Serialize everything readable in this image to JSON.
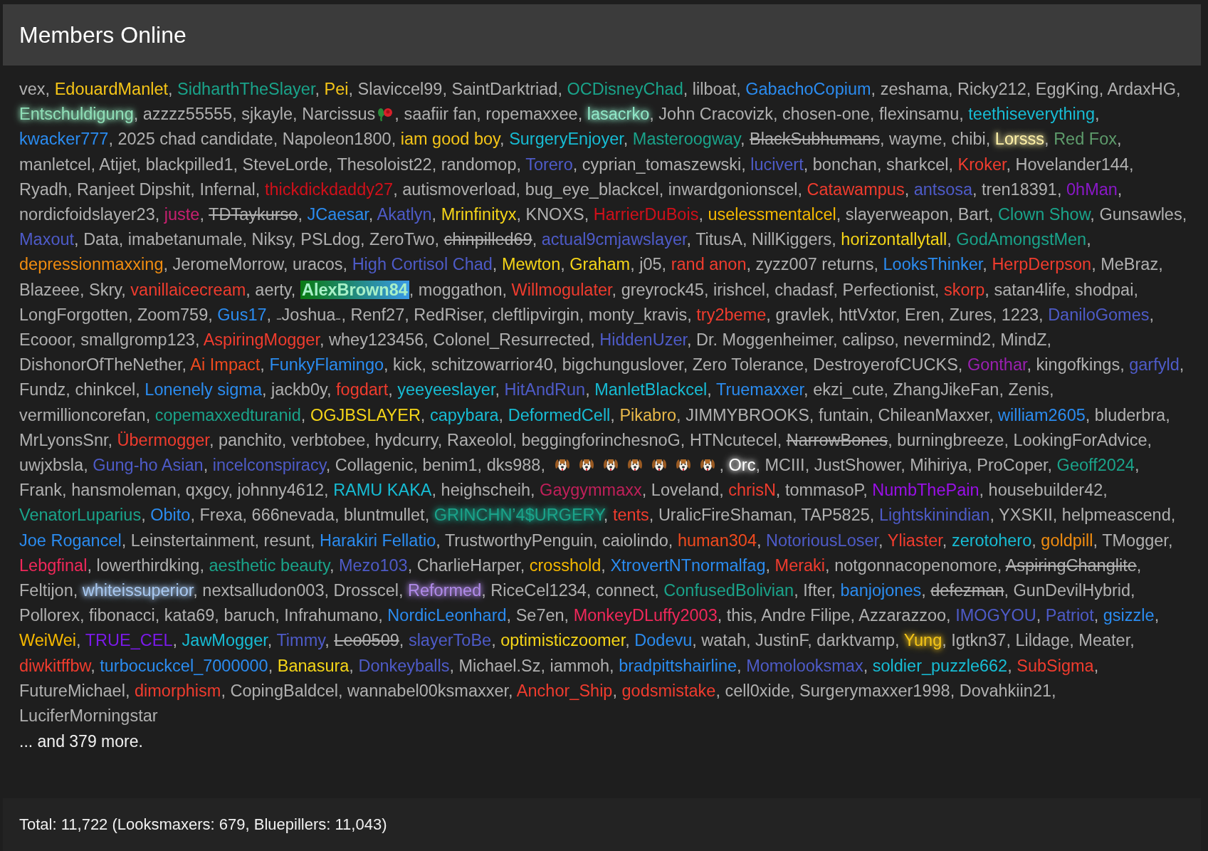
{
  "panel": {
    "title": "Members Online"
  },
  "members": {
    "separator": ", ",
    "items": [
      {
        "name": "vex"
      },
      {
        "name": "EdouardManlet",
        "color": "#f5c518"
      },
      {
        "name": "SidharthTheSlayer",
        "color": "#1aa38a"
      },
      {
        "name": "Pei",
        "color": "#f5c518"
      },
      {
        "name": "Slaviccel99"
      },
      {
        "name": "SaintDarktriad"
      },
      {
        "name": "OCDisneyChad",
        "color": "#1aa38a"
      },
      {
        "name": "lilboat"
      },
      {
        "name": "GabachoCopium",
        "color": "#2b8cf0"
      },
      {
        "name": "zeshama"
      },
      {
        "name": "Ricky212"
      },
      {
        "name": "EggKing"
      },
      {
        "name": "ArdaxHG"
      },
      {
        "name": "Entschuldigung",
        "color": "#90e0b8",
        "glow": true
      },
      {
        "name": "azzzz55555"
      },
      {
        "name": "sjkayle"
      },
      {
        "name": "Narcissus",
        "icons": [
          {
            "kind": "flower"
          }
        ]
      },
      {
        "name": "saafiir fan"
      },
      {
        "name": "ropemaxxee"
      },
      {
        "name": "lasacrko",
        "color": "#90e8c8",
        "glow": true
      },
      {
        "name": "John Cracovizk"
      },
      {
        "name": "chosen-one"
      },
      {
        "name": "flexinsamu"
      },
      {
        "name": "teethiseverything",
        "color": "#17bcd4"
      },
      {
        "name": "kwacker777",
        "color": "#2b8cf0"
      },
      {
        "name": "2025 chad candidate"
      },
      {
        "name": "Napoleon1800"
      },
      {
        "name": "iam good boy",
        "color": "#f5c518"
      },
      {
        "name": "SurgeryEnjoyer",
        "color": "#17bcd4"
      },
      {
        "name": "Masteroogway",
        "color": "#1aa38a"
      },
      {
        "name": "BlackSubhumans",
        "struck": true
      },
      {
        "name": "wayme"
      },
      {
        "name": "chibi"
      },
      {
        "name": "Lorsss",
        "color": "#fff2a8",
        "glow": true
      },
      {
        "name": "Red Fox",
        "color": "#5e9c6c"
      },
      {
        "name": "manletcel"
      },
      {
        "name": "Atijet"
      },
      {
        "name": "blackpilled1"
      },
      {
        "name": "SteveLorde"
      },
      {
        "name": "Thesoloist22"
      },
      {
        "name": "randomop"
      },
      {
        "name": "Torero",
        "color": "#4e5bc8"
      },
      {
        "name": "cyprian_tomaszewski"
      },
      {
        "name": "lucivert",
        "color": "#4e5bc8"
      },
      {
        "name": "bonchan"
      },
      {
        "name": "sharkcel"
      },
      {
        "name": "Kroker",
        "color": "#f03c2e"
      },
      {
        "name": "Hovelander144"
      },
      {
        "name": "Ryadh"
      },
      {
        "name": "Ranjeet Dipshit"
      },
      {
        "name": "Infernal"
      },
      {
        "name": "thickdickdaddy27",
        "color": "#d0101a"
      },
      {
        "name": "autismoverload"
      },
      {
        "name": "bug_eye_blackcel"
      },
      {
        "name": "inwardgonionscel"
      },
      {
        "name": "Catawampus",
        "color": "#f03c2e"
      },
      {
        "name": "antsosa",
        "color": "#4e5bc8"
      },
      {
        "name": "tren18391"
      },
      {
        "name": "0hMan",
        "color": "#8a18c8"
      },
      {
        "name": "nordicfoidslayer23"
      },
      {
        "name": "juste",
        "color": "#c82070"
      },
      {
        "name": "TDTaykurso",
        "struck": true
      },
      {
        "name": "JCaesar",
        "color": "#2b8cf0"
      },
      {
        "name": "Akatlyn",
        "color": "#4e5bc8"
      },
      {
        "name": "Mrinfinityx",
        "color": "#f5d518"
      },
      {
        "name": "KNOXS"
      },
      {
        "name": "HarrierDuBois",
        "color": "#d0101a"
      },
      {
        "name": "uselessmentalcel",
        "color": "#f5b800"
      },
      {
        "name": "slayerweapon"
      },
      {
        "name": "Bart"
      },
      {
        "name": "Clown Show",
        "color": "#1aa38a"
      },
      {
        "name": "Gunsawles"
      },
      {
        "name": "Maxout",
        "color": "#4e5bc8"
      },
      {
        "name": "Data"
      },
      {
        "name": "imabetanumale"
      },
      {
        "name": "Niksy"
      },
      {
        "name": "PSLdog"
      },
      {
        "name": "ZeroTwo"
      },
      {
        "name": "chinpilled69",
        "struck": true
      },
      {
        "name": "actual9cmjawslayer",
        "color": "#4e5bc8"
      },
      {
        "name": "TitusA"
      },
      {
        "name": "NillKiggers"
      },
      {
        "name": "horizontallytall",
        "color": "#f5d518"
      },
      {
        "name": "GodAmongstMen",
        "color": "#1aa38a"
      },
      {
        "name": "depressionmaxxing",
        "color": "#f08c10"
      },
      {
        "name": "JeromeMorrow"
      },
      {
        "name": "uracos"
      },
      {
        "name": "High Cortisol Chad",
        "color": "#4e5bc8"
      },
      {
        "name": "Mewton",
        "color": "#f5d518"
      },
      {
        "name": "Graham",
        "color": "#f5d518"
      },
      {
        "name": "j05"
      },
      {
        "name": "rand anon",
        "color": "#f03c2e"
      },
      {
        "name": "zyzz007 returns"
      },
      {
        "name": "LooksThinker",
        "color": "#2b8cf0"
      },
      {
        "name": "HerpDerpson",
        "color": "#f03c2e"
      },
      {
        "name": "MeBraz"
      },
      {
        "name": "Blazeee"
      },
      {
        "name": "Skry"
      },
      {
        "name": "vanillaicecream",
        "color": "#f03c2e"
      },
      {
        "name": "aerty"
      },
      {
        "name": "AlexBrown84",
        "highlighted": true
      },
      {
        "name": "moggathon"
      },
      {
        "name": "Willmogulater",
        "color": "#f03c2e"
      },
      {
        "name": "greyrock45"
      },
      {
        "name": "irishcel"
      },
      {
        "name": "chadasf"
      },
      {
        "name": "Perfectionist"
      },
      {
        "name": "skorp",
        "color": "#f03c2e"
      },
      {
        "name": "satan4life"
      },
      {
        "name": "shodpai"
      },
      {
        "name": "LongForgotten"
      },
      {
        "name": "Zoom759"
      },
      {
        "name": "Gus17",
        "color": "#2b8cf0"
      },
      {
        "name": "₋Joshua₋"
      },
      {
        "name": "Renf27"
      },
      {
        "name": "RedRiser"
      },
      {
        "name": "cleftlipvirgin"
      },
      {
        "name": "monty_kravis"
      },
      {
        "name": "try2beme",
        "color": "#f03c2e"
      },
      {
        "name": "gravlek"
      },
      {
        "name": "httVxtor"
      },
      {
        "name": "Eren"
      },
      {
        "name": "Zures"
      },
      {
        "name": "1223"
      },
      {
        "name": "DaniloGomes",
        "color": "#4e5bc8"
      },
      {
        "name": "Ecooor"
      },
      {
        "name": "smallgromp123"
      },
      {
        "name": "AspiringMogger",
        "color": "#f03c2e"
      },
      {
        "name": "whey123456"
      },
      {
        "name": "Colonel_Resurrected"
      },
      {
        "name": "HiddenUzer",
        "color": "#4e5bc8"
      },
      {
        "name": "Dr. Moggenheimer"
      },
      {
        "name": "calipso"
      },
      {
        "name": "nevermind2"
      },
      {
        "name": "MindZ"
      },
      {
        "name": "DishonorOfTheNether"
      },
      {
        "name": "Ai Impact",
        "color": "#f04a1e"
      },
      {
        "name": "FunkyFlamingo",
        "color": "#2b8cf0"
      },
      {
        "name": "kick"
      },
      {
        "name": "schitzowarrior40"
      },
      {
        "name": "bigchunguslover"
      },
      {
        "name": "Zero Tolerance"
      },
      {
        "name": "DestroyerofCUCKS"
      },
      {
        "name": "Gonthar",
        "color": "#9a20b0"
      },
      {
        "name": "kingofkings"
      },
      {
        "name": "garfyld",
        "color": "#4e5bc8"
      },
      {
        "name": "Fundz"
      },
      {
        "name": "chinkcel"
      },
      {
        "name": "Lonenely sigma",
        "color": "#2b8cf0"
      },
      {
        "name": "jackb0y"
      },
      {
        "name": "fogdart",
        "color": "#f03c2e"
      },
      {
        "name": "yeeyeeslayer",
        "color": "#17bcd4"
      },
      {
        "name": "HitAndRun",
        "color": "#4e5bc8"
      },
      {
        "name": "ManletBlackcel",
        "color": "#17bcd4"
      },
      {
        "name": "Truemaxxer",
        "color": "#2b8cf0"
      },
      {
        "name": "ekzi_cute"
      },
      {
        "name": "ZhangJikeFan"
      },
      {
        "name": "Zenis"
      },
      {
        "name": "vermillioncorefan"
      },
      {
        "name": "copemaxxedturanid",
        "color": "#1aa38a"
      },
      {
        "name": "OGJBSLAYER",
        "color": "#f5d518"
      },
      {
        "name": "capybara",
        "color": "#17bcd4"
      },
      {
        "name": "DeformedCell",
        "color": "#17bcd4"
      },
      {
        "name": "Pikabro",
        "color": "#e8b84a"
      },
      {
        "name": "JIMMYBROOKS"
      },
      {
        "name": "funtain"
      },
      {
        "name": "ChileanMaxxer"
      },
      {
        "name": "william2605",
        "color": "#2b8cf0"
      },
      {
        "name": "bluderbra"
      },
      {
        "name": "MrLyonsSnr"
      },
      {
        "name": "Übermogger",
        "color": "#f03c2e"
      },
      {
        "name": "panchito"
      },
      {
        "name": "verbtobee"
      },
      {
        "name": "hydcurry"
      },
      {
        "name": "Raxeolol"
      },
      {
        "name": "beggingforinchesnoG"
      },
      {
        "name": "HTNcutecel"
      },
      {
        "name": "NarrowBones",
        "struck": true
      },
      {
        "name": "burningbreeze"
      },
      {
        "name": "LookingForAdvice"
      },
      {
        "name": "uwjxbsla"
      },
      {
        "name": "Gung-ho Asian",
        "color": "#4e5bc8"
      },
      {
        "name": "incelconspiracy",
        "color": "#4e5bc8"
      },
      {
        "name": "Collagenic"
      },
      {
        "name": "benim1"
      },
      {
        "name": "dks988"
      },
      {
        "icons": [
          {
            "kind": "dog"
          },
          {
            "kind": "dog"
          },
          {
            "kind": "dog"
          },
          {
            "kind": "dog"
          },
          {
            "kind": "dog"
          },
          {
            "kind": "dog"
          },
          {
            "kind": "dog"
          }
        ]
      },
      {
        "name": "Orc",
        "color": "#ffffff",
        "glow": true
      },
      {
        "name": "MCIII"
      },
      {
        "name": "JustShower"
      },
      {
        "name": "Mihiriya"
      },
      {
        "name": "ProCoper"
      },
      {
        "name": "Geoff2024",
        "color": "#1aa38a"
      },
      {
        "name": "Frank"
      },
      {
        "name": "hansmoleman"
      },
      {
        "name": "qxgcy"
      },
      {
        "name": "johnny4612"
      },
      {
        "name": "RAMU KAKA",
        "color": "#17bcd4"
      },
      {
        "name": "heighscheih"
      },
      {
        "name": "Gaygymmaxx",
        "color": "#c0205a"
      },
      {
        "name": "Loveland"
      },
      {
        "name": "chrisN",
        "color": "#f03c2e"
      },
      {
        "name": "tommasoP"
      },
      {
        "name": "NumbThePain",
        "color": "#9a10e8"
      },
      {
        "name": "housebuilder42"
      },
      {
        "name": "VenatorLuparius",
        "color": "#1aa38a"
      },
      {
        "name": "Obito",
        "color": "#2b8cf0"
      },
      {
        "name": "Frexa"
      },
      {
        "name": "666nevada"
      },
      {
        "name": "bluntmullet"
      },
      {
        "name": "GRINCHN’4$URGERY",
        "color": "#1aa38a",
        "glow": true
      },
      {
        "name": "tents",
        "color": "#f03c2e"
      },
      {
        "name": "UralicFireShaman"
      },
      {
        "name": "TAP5825"
      },
      {
        "name": "Lightskinindian",
        "color": "#4e5bc8"
      },
      {
        "name": "YXSKII"
      },
      {
        "name": "helpmeascend"
      },
      {
        "name": "Joe Rogancel",
        "color": "#2b8cf0"
      },
      {
        "name": "Leinstertainment"
      },
      {
        "name": "resunt"
      },
      {
        "name": "Harakiri Fellatio",
        "color": "#2b8cf0"
      },
      {
        "name": "TrustworthyPenguin"
      },
      {
        "name": "caiolindo"
      },
      {
        "name": "human304",
        "color": "#f04a1e"
      },
      {
        "name": "NotoriousLoser",
        "color": "#4e5bc8"
      },
      {
        "name": "Yliaster",
        "color": "#f03c2e"
      },
      {
        "name": "zerotohero",
        "color": "#17bcd4"
      },
      {
        "name": "goldpill",
        "color": "#f08c10"
      },
      {
        "name": "TMogger"
      },
      {
        "name": "Lebgfinal",
        "color": "#f0285a"
      },
      {
        "name": "lowerthirdking"
      },
      {
        "name": "aesthetic beauty",
        "color": "#1aa38a"
      },
      {
        "name": "Mezo103",
        "color": "#4e5bc8"
      },
      {
        "name": "CharlieHarper"
      },
      {
        "name": "crosshold",
        "color": "#f5b800"
      },
      {
        "name": "XtrovertNTnormalfag",
        "color": "#2b8cf0"
      },
      {
        "name": "Meraki",
        "color": "#f03c2e"
      },
      {
        "name": "notgonnacopenomore"
      },
      {
        "name": "AspiringChanglite",
        "struck": true
      },
      {
        "name": "Feltijon"
      },
      {
        "name": "whiteissuperior",
        "color": "#a8c8f0",
        "glow": true
      },
      {
        "name": "nextsalludon003"
      },
      {
        "name": "Drosscel"
      },
      {
        "name": "Reformed",
        "color": "#b08ae8",
        "glow": true
      },
      {
        "name": "RiceCel1234"
      },
      {
        "name": "connect"
      },
      {
        "name": "ConfusedBolivian",
        "color": "#1aa38a"
      },
      {
        "name": "Ifter"
      },
      {
        "name": "banjojones",
        "color": "#2b8cf0"
      },
      {
        "name": "defezman",
        "struck": true
      },
      {
        "name": "GunDevilHybrid"
      },
      {
        "name": "Pollorex"
      },
      {
        "name": "fibonacci"
      },
      {
        "name": "kata69"
      },
      {
        "name": "baruch"
      },
      {
        "name": "Infrahumano"
      },
      {
        "name": "NordicLeonhard",
        "color": "#2b8cf0"
      },
      {
        "name": "Se7en"
      },
      {
        "name": "MonkeyDLuffy2003",
        "color": "#f0285a"
      },
      {
        "name": "this"
      },
      {
        "name": "Andre Filipe"
      },
      {
        "name": "Azzarazzoo"
      },
      {
        "name": "IMOGYOU",
        "color": "#4e5bc8"
      },
      {
        "name": "Patriot",
        "color": "#4e5bc8"
      },
      {
        "name": "gsizzle",
        "color": "#2b8cf0"
      },
      {
        "name": "WeiWei",
        "color": "#f5b800"
      },
      {
        "name": "TRUE_CEL",
        "color": "#7a1ae8"
      },
      {
        "name": "JawMogger",
        "color": "#17bcd4"
      },
      {
        "name": "Timmy",
        "color": "#4e5bc8"
      },
      {
        "name": "Leo0509",
        "struck": true
      },
      {
        "name": "slayerToBe",
        "color": "#4e5bc8"
      },
      {
        "name": "optimisticzoomer",
        "color": "#f5d518"
      },
      {
        "name": "Dodevu",
        "color": "#2b8cf0"
      },
      {
        "name": "watah"
      },
      {
        "name": "JustinF"
      },
      {
        "name": "darktvamp"
      },
      {
        "name": "Yung",
        "color": "#f5c518",
        "glow": true
      },
      {
        "name": "Igtkn37"
      },
      {
        "name": "Lildage"
      },
      {
        "name": "Meater"
      },
      {
        "name": "diwkitffbw",
        "color": "#f03c2e"
      },
      {
        "name": "turbocuckcel_7000000",
        "color": "#2b8cf0"
      },
      {
        "name": "Banasura",
        "color": "#f5d518"
      },
      {
        "name": "Donkeyballs",
        "color": "#4e5bc8"
      },
      {
        "name": "Michael.Sz"
      },
      {
        "name": "iammoh"
      },
      {
        "name": "bradpittshairline",
        "color": "#2b8cf0"
      },
      {
        "name": "Momolooksmax",
        "color": "#4e5bc8"
      },
      {
        "name": "soldier_puzzle662",
        "color": "#17bcd4"
      },
      {
        "name": "SubSigma",
        "color": "#f03c2e"
      },
      {
        "name": "FutureMichael"
      },
      {
        "name": "dimorphism",
        "color": "#f03c2e"
      },
      {
        "name": "CopingBaldcel"
      },
      {
        "name": "wannabel00ksmaxxer"
      },
      {
        "name": "Anchor_Ship",
        "color": "#f03c2e"
      },
      {
        "name": "godsmistake",
        "color": "#f03c2e"
      },
      {
        "name": "cell0xide"
      },
      {
        "name": "Surgerymaxxer1998"
      },
      {
        "name": "Dovahkiin21"
      },
      {
        "name": "LuciferMorningstar"
      }
    ],
    "more": "... and 379 more."
  },
  "footer": {
    "total": "Total: 11,722 (Looksmaxers: 679, Bluepillers: 11,043)"
  }
}
